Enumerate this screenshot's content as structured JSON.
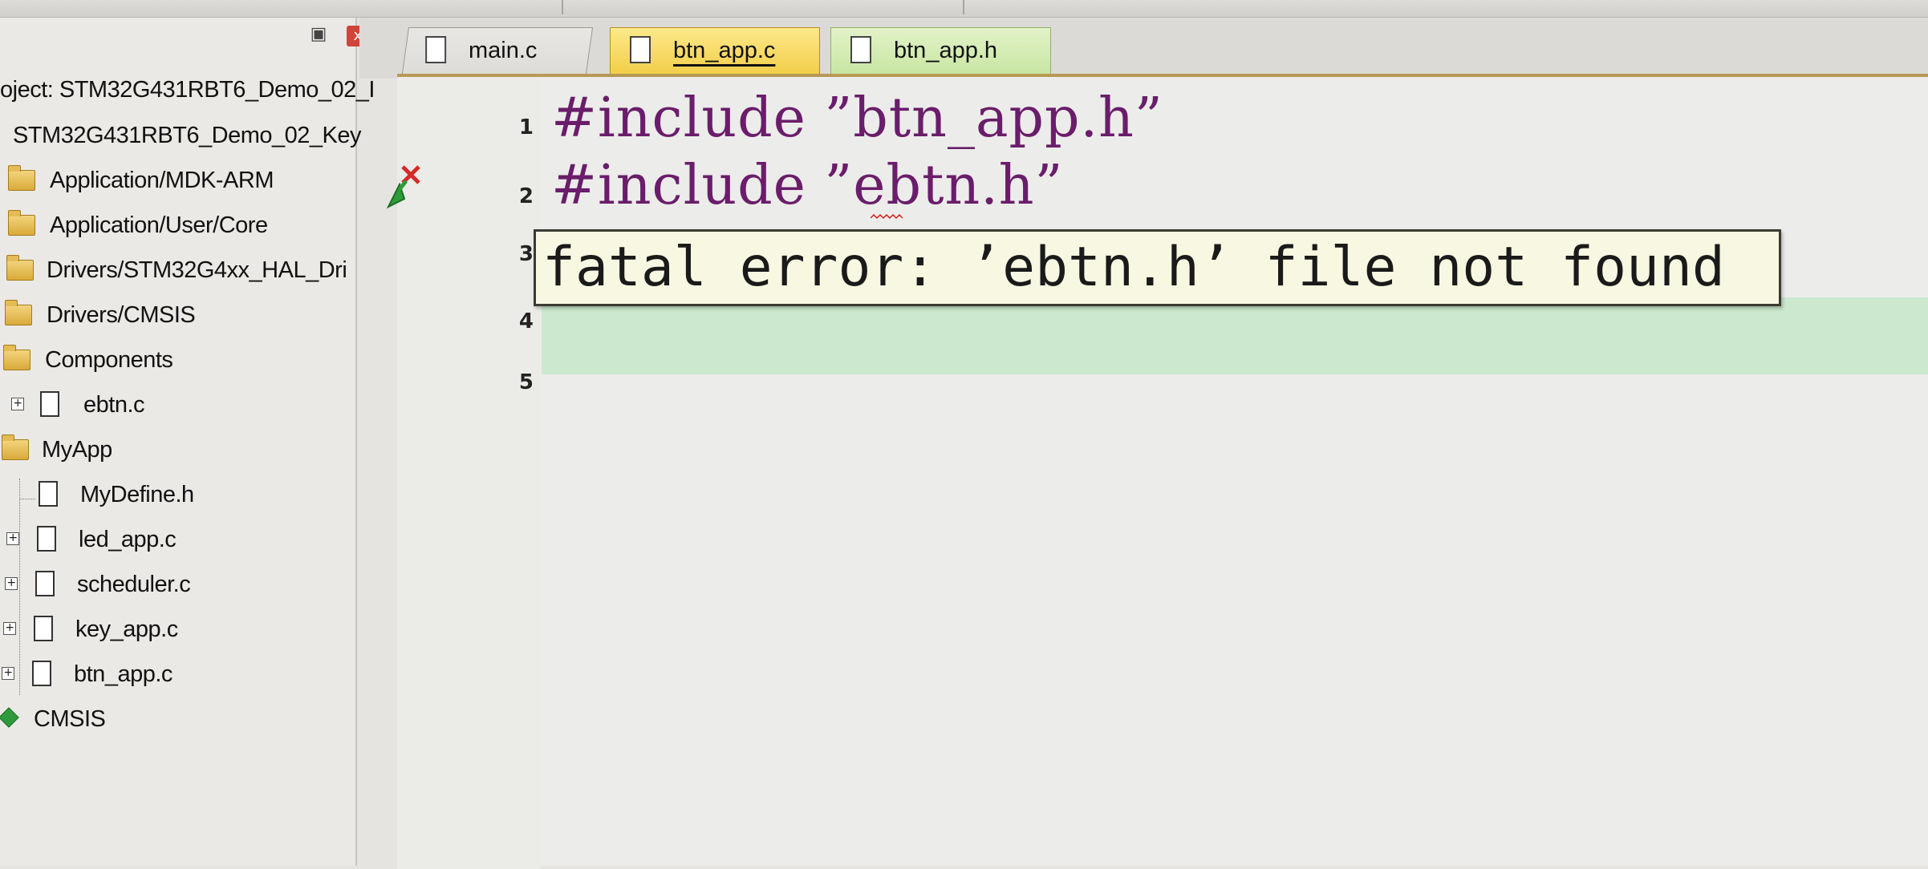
{
  "project_pane": {
    "pin_glyph": "▣",
    "close_glyph": "x",
    "items": [
      {
        "label": "oject: STM32G431RBT6_Demo_02_I",
        "kind": "project-root"
      },
      {
        "label": "STM32G431RBT6_Demo_02_Key",
        "kind": "target"
      },
      {
        "label": "Application/MDK-ARM",
        "kind": "folder"
      },
      {
        "label": "Application/User/Core",
        "kind": "folder"
      },
      {
        "label": "Drivers/STM32G4xx_HAL_Dri",
        "kind": "folder"
      },
      {
        "label": "Drivers/CMSIS",
        "kind": "folder"
      },
      {
        "label": "Components",
        "kind": "folder-open"
      },
      {
        "label": "ebtn.c",
        "kind": "file-expandable"
      },
      {
        "label": "MyApp",
        "kind": "folder-open"
      },
      {
        "label": "MyDefine.h",
        "kind": "file"
      },
      {
        "label": "led_app.c",
        "kind": "file-expandable"
      },
      {
        "label": "scheduler.c",
        "kind": "file-expandable"
      },
      {
        "label": "key_app.c",
        "kind": "file-expandable"
      },
      {
        "label": "btn_app.c",
        "kind": "file-expandable"
      },
      {
        "label": "CMSIS",
        "kind": "component"
      }
    ]
  },
  "tabs": [
    {
      "label": "main.c",
      "state": "inactive"
    },
    {
      "label": "btn_app.c",
      "state": "active"
    },
    {
      "label": "btn_app.h",
      "state": "inactive"
    }
  ],
  "editor": {
    "lines": [
      {
        "num": "1",
        "code": "#include ”btn_app.h”"
      },
      {
        "num": "2",
        "code": "#include ”ebtn.h”"
      },
      {
        "num": "3",
        "code": ""
      },
      {
        "num": "4",
        "code": ""
      },
      {
        "num": "5",
        "code": ""
      }
    ],
    "tooltip": "fatal error: ’ebtn.h’ file not found",
    "colors": {
      "keyword": "#6a1d6a",
      "current_line": "#cce8cf",
      "tooltip_bg": "#f7f7e2",
      "active_tab": "#f2cf4a",
      "header_tab": "#c8e6a3"
    }
  }
}
